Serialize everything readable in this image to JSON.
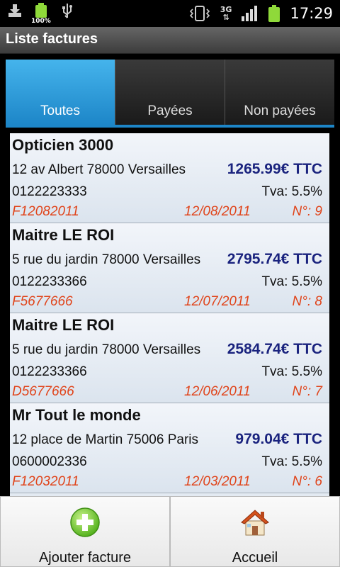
{
  "statusbar": {
    "battery_small_percent": "100%",
    "network_type": "3G",
    "time": "17:29"
  },
  "titlebar": {
    "title": "Liste factures"
  },
  "tabs": [
    {
      "label": "Toutes",
      "active": true
    },
    {
      "label": "Payées",
      "active": false
    },
    {
      "label": "Non payées",
      "active": false
    }
  ],
  "invoices": [
    {
      "name": "Opticien 3000",
      "address": "12 av Albert 78000 Versailles",
      "amount": "1265.99€ TTC",
      "phone": "0122223333",
      "tva": "Tva: 5.5%",
      "ref": "F12082011",
      "date": "12/08/2011",
      "number": "N°: 9"
    },
    {
      "name": "Maitre LE ROI",
      "address": "5 rue du jardin 78000 Versailles",
      "amount": "2795.74€ TTC",
      "phone": "0122233366",
      "tva": "Tva: 5.5%",
      "ref": "F5677666",
      "date": "12/07/2011",
      "number": "N°: 8"
    },
    {
      "name": "Maitre LE ROI",
      "address": "5 rue du jardin 78000 Versailles",
      "amount": "2584.74€ TTC",
      "phone": "0122233366",
      "tva": "Tva: 5.5%",
      "ref": "D5677666",
      "date": "12/06/2011",
      "number": "N°: 7"
    },
    {
      "name": "Mr Tout le monde",
      "address": "12 place de Martin 75006 Paris",
      "amount": "979.04€ TTC",
      "phone": "0600002336",
      "tva": "Tva: 5.5%",
      "ref": "F12032011",
      "date": "12/03/2011",
      "number": "N°: 6"
    }
  ],
  "bottom": {
    "add_label": "Ajouter facture",
    "home_label": "Accueil"
  },
  "colors": {
    "tab_active": "#1d86c8",
    "amount": "#1a237e",
    "ref_text": "#e0441a",
    "battery": "#8fd93a"
  },
  "icons": {
    "add": "plus-circle-icon",
    "home": "house-icon"
  }
}
